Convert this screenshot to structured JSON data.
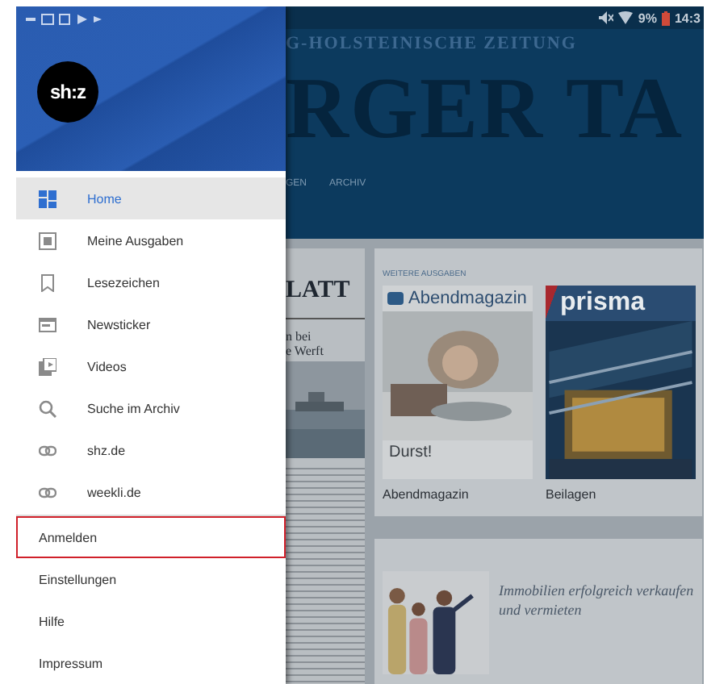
{
  "status_bar": {
    "battery": "9%",
    "time": "14:3"
  },
  "drawer": {
    "logo": "sh:z",
    "items": [
      {
        "label": "Home",
        "selected": true
      },
      {
        "label": "Meine Ausgaben",
        "selected": false
      },
      {
        "label": "Lesezeichen",
        "selected": false
      },
      {
        "label": "Newsticker",
        "selected": false
      },
      {
        "label": "Videos",
        "selected": false
      },
      {
        "label": "Suche im Archiv",
        "selected": false
      },
      {
        "label": "shz.de",
        "selected": false
      },
      {
        "label": "weekli.de",
        "selected": false
      }
    ],
    "secondary_items": [
      {
        "label": "Anmelden",
        "highlighted": true
      },
      {
        "label": "Einstellungen",
        "highlighted": false
      },
      {
        "label": "Hilfe",
        "highlighted": false
      },
      {
        "label": "Impressum",
        "highlighted": false
      }
    ]
  },
  "background": {
    "masthead_subtitle": "G-HOLSTEINISCHE ZEITUNG",
    "masthead_title": "RGER TA",
    "tabs": [
      "GEN",
      "ARCHIV"
    ],
    "newspaper": {
      "title": "LATT",
      "headline_lines": [
        "n bei",
        "e Werft"
      ]
    },
    "more_editions": {
      "label": "WEITERE AUSGABEN",
      "covers": [
        {
          "kind": "magazine",
          "masthead": "Abendmagazin",
          "cover_line": "Durst!",
          "caption": "Abendmagazin"
        },
        {
          "kind": "supplement",
          "masthead": "prisma",
          "caption": "Beilagen"
        }
      ]
    },
    "ad": {
      "headline": "Immobilien erfolgreich verkaufen und vermieten"
    }
  }
}
